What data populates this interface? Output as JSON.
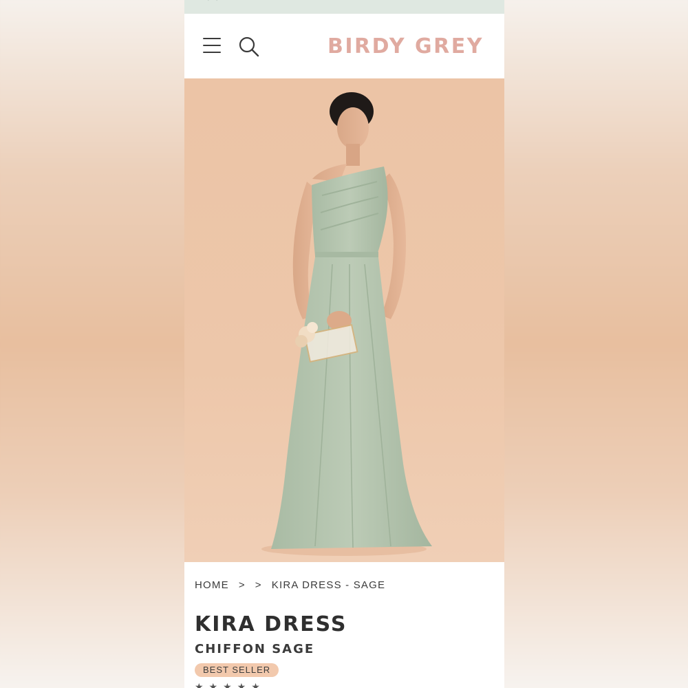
{
  "header": {
    "brand": "BIRDY GREY",
    "menu_icon": "hamburger-menu-icon",
    "search_icon": "search-icon"
  },
  "breadcrumb": {
    "home": "HOME",
    "separator_1": ">",
    "separator_2": ">",
    "current": "KIRA DRESS - SAGE"
  },
  "product": {
    "name": "KIRA DRESS",
    "variant": "CHIFFON SAGE",
    "badge": "BEST SELLER",
    "rating_stars": "★★★★★"
  },
  "colors": {
    "brand": "#e0aaa0",
    "badge": "#f2c9ad",
    "dress": "#b3c4ae",
    "backdrop": "#ecc4a6"
  }
}
